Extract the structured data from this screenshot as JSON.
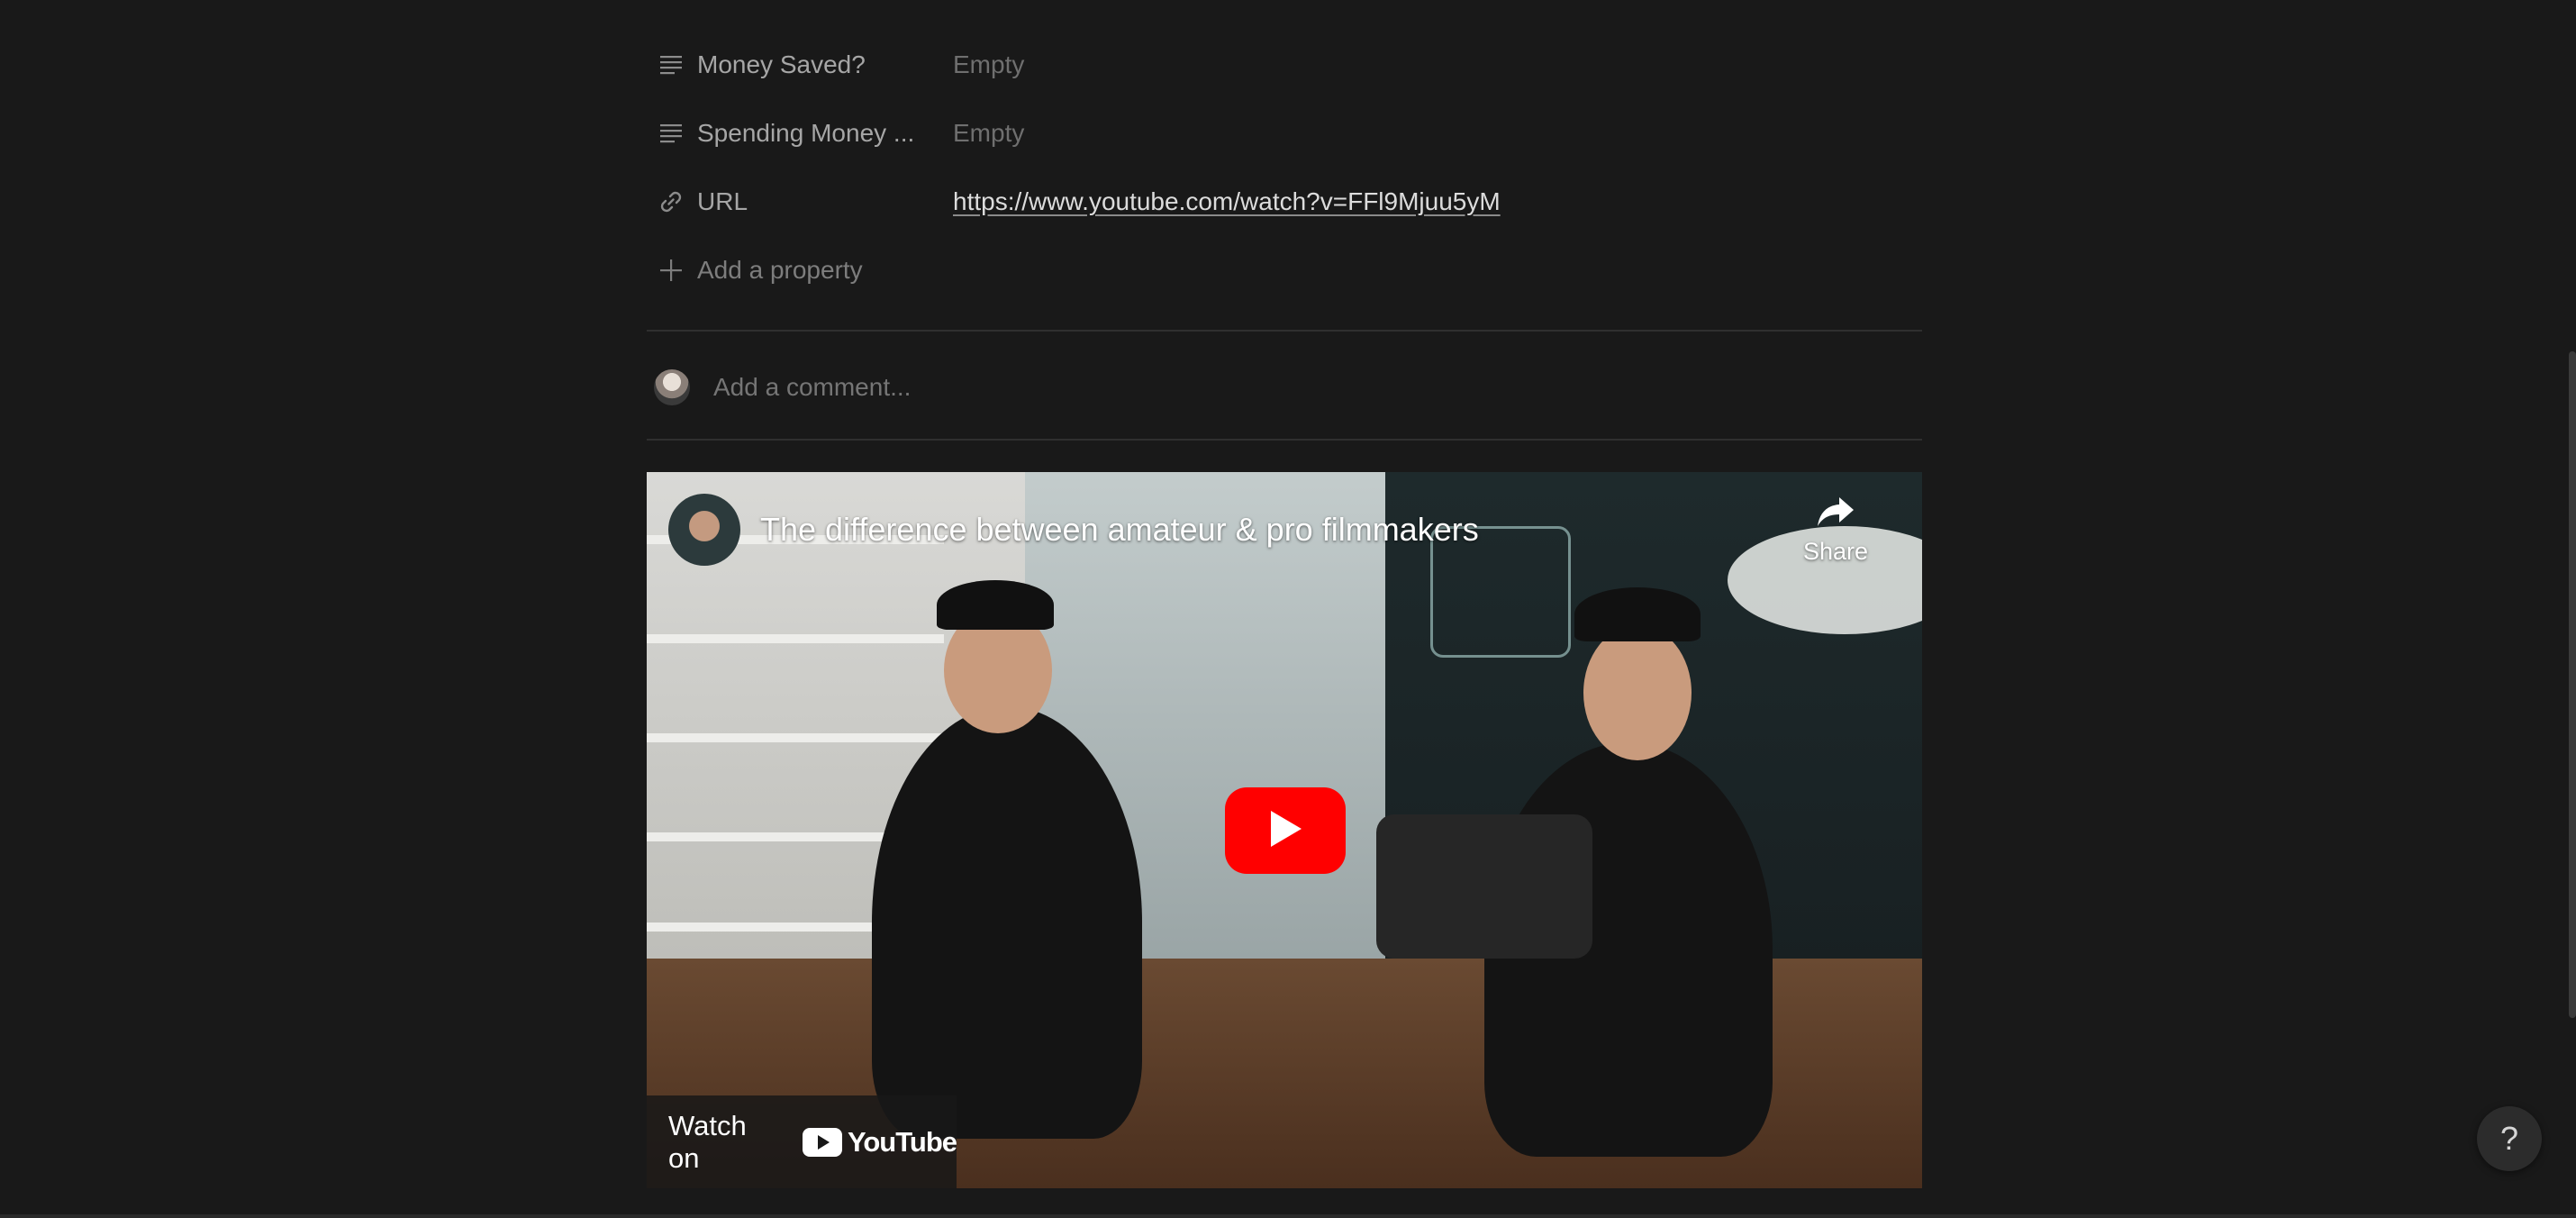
{
  "properties": [
    {
      "name": "Money Saved?",
      "value": "Empty",
      "icon": "text-lines-icon"
    },
    {
      "name": "Spending Money ...",
      "value": "Empty",
      "icon": "text-lines-icon"
    },
    {
      "name": "URL",
      "value": "https://www.youtube.com/watch?v=FFl9Mjuu5yM",
      "icon": "link-icon"
    }
  ],
  "add_property": {
    "label": "Add a property",
    "icon": "plus-icon"
  },
  "comment": {
    "placeholder": "Add a comment..."
  },
  "video": {
    "title": "The difference between amateur & pro filmmakers",
    "share_label": "Share",
    "watch_on_label": "Watch on",
    "youtube_wordmark": "YouTube",
    "play_color": "#ff0000"
  },
  "help": {
    "label": "?"
  }
}
